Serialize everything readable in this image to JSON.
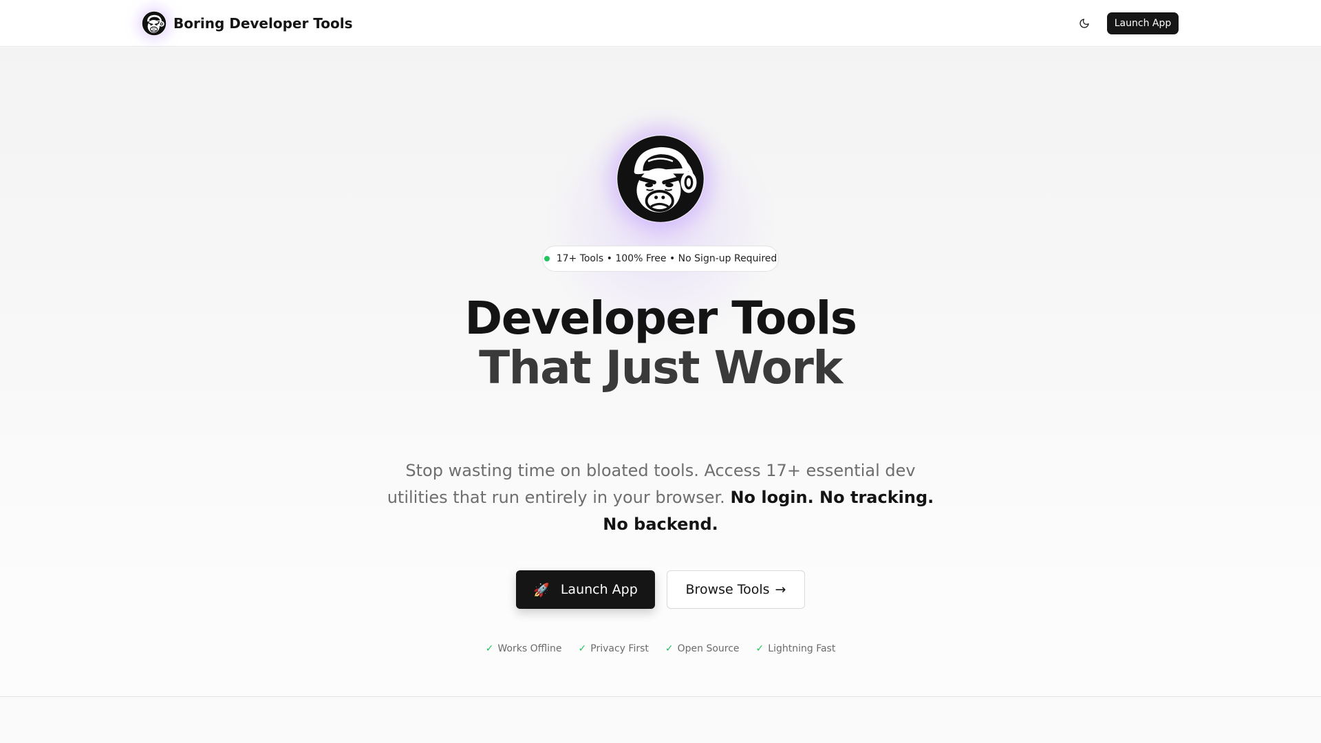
{
  "nav": {
    "brand_name": "Boring Developer Tools",
    "launch_label": "Launch App"
  },
  "hero": {
    "badge_text": "17+ Tools • 100% Free • No Sign-up Required",
    "title_line1": "Developer Tools",
    "title_line2": "That Just Work",
    "description_regular": "Stop wasting time on bloated tools. Access 17+ essential dev utilities that run entirely in your browser. ",
    "description_bold": "No login. No tracking. No backend.",
    "primary_cta_icon": "🚀",
    "primary_cta_label": "Launch App",
    "secondary_cta_label": "Browse Tools",
    "secondary_cta_arrow": "→",
    "features": [
      {
        "label": "Works Offline"
      },
      {
        "label": "Privacy First"
      },
      {
        "label": "Open Source"
      },
      {
        "label": "Lightning Fast"
      }
    ]
  },
  "colors": {
    "accent_dark": "#151515",
    "check_green": "#22c55e",
    "glow_purple": "#b98cff"
  },
  "icons": {
    "logo": "monkey-logo-icon",
    "theme": "moon-icon",
    "check": "check-icon",
    "rocket": "rocket-icon"
  }
}
